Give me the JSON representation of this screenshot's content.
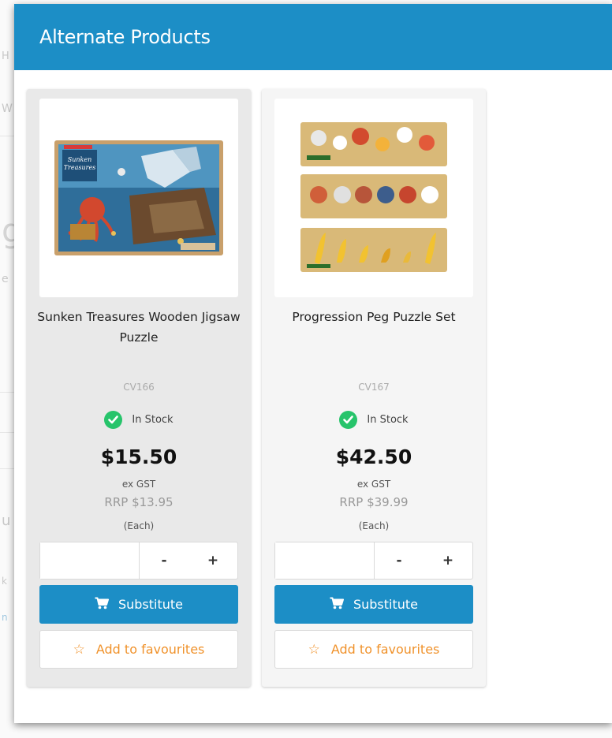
{
  "modal": {
    "title": "Alternate Products"
  },
  "colors": {
    "header": "#1c8ec6",
    "substitute_button": "#1c8ec6",
    "in_stock": "#27c46b",
    "favourite": "#f0922b"
  },
  "products": [
    {
      "name": "Sunken Treasures Wooden Jigsaw Puzzle",
      "sku": "CV166",
      "stock_status": "In Stock",
      "stock_icon": "check-circle-icon",
      "price": "$15.50",
      "tax_note": "ex GST",
      "rrp": "RRP $13.95",
      "unit": "(Each)",
      "quantity": "",
      "decrement_label": "-",
      "increment_label": "+",
      "substitute_label": "Substitute",
      "substitute_icon": "cart-icon",
      "favourite_label": "Add to favourites",
      "favourite_icon": "star-icon"
    },
    {
      "name": "Progression Peg Puzzle Set",
      "sku": "CV167",
      "stock_status": "In Stock",
      "stock_icon": "check-circle-icon",
      "price": "$42.50",
      "tax_note": "ex GST",
      "rrp": "RRP $39.99",
      "unit": "(Each)",
      "quantity": "",
      "decrement_label": "-",
      "increment_label": "+",
      "substitute_label": "Substitute",
      "substitute_icon": "cart-icon",
      "favourite_label": "Add to favourites",
      "favourite_icon": "star-icon"
    }
  ]
}
